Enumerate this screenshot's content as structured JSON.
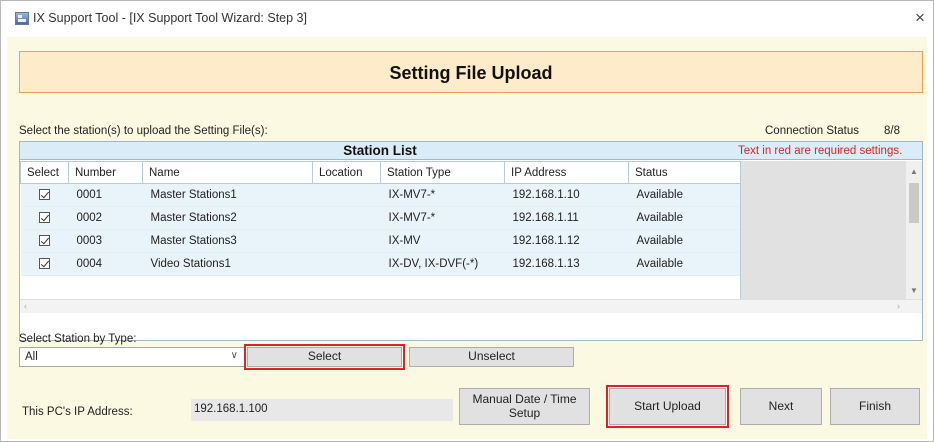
{
  "window": {
    "title": "IX Support Tool - [IX Support Tool Wizard: Step 3]",
    "close_glyph": "×"
  },
  "header": {
    "title": "Setting File Upload"
  },
  "instruction": "Select the station(s) to upload the Setting File(s):",
  "connection": {
    "label": "Connection Status",
    "value": "8/8"
  },
  "station_list": {
    "title": "Station List",
    "required_note": "Text in red are required settings.",
    "columns": [
      "Select",
      "Number",
      "Name",
      "Location",
      "Station Type",
      "IP Address",
      "Status"
    ],
    "rows": [
      {
        "selected": true,
        "number": "0001",
        "name": "Master Stations1",
        "location": "",
        "type": "IX-MV7-*",
        "ip": "192.168.1.10",
        "status": "Available"
      },
      {
        "selected": true,
        "number": "0002",
        "name": "Master Stations2",
        "location": "",
        "type": "IX-MV7-*",
        "ip": "192.168.1.11",
        "status": "Available"
      },
      {
        "selected": true,
        "number": "0003",
        "name": "Master Stations3",
        "location": "",
        "type": "IX-MV",
        "ip": "192.168.1.12",
        "status": "Available"
      },
      {
        "selected": true,
        "number": "0004",
        "name": "Video Stations1",
        "location": "",
        "type": "IX-DV, IX-DVF(-*)",
        "ip": "192.168.1.13",
        "status": "Available"
      }
    ]
  },
  "select_by_type": {
    "label": "Select Station by Type:",
    "value": "All"
  },
  "buttons": {
    "select": "Select",
    "unselect": "Unselect",
    "manual_time": "Manual Date / Time Setup",
    "start_upload": "Start Upload",
    "next": "Next",
    "finish": "Finish"
  },
  "pc_ip": {
    "label": "This PC's IP Address:",
    "value": "192.168.1.100"
  },
  "colors": {
    "highlight": "#d8242c",
    "header_border": "#f0a050",
    "required_text": "#e0241c",
    "panel_bg": "#fbf9e1"
  }
}
